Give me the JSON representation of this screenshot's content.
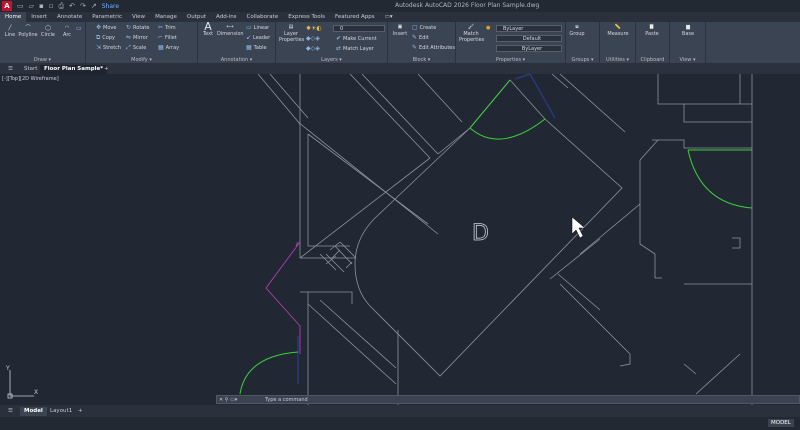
{
  "titlebar": {
    "app_logo": "A",
    "share_label": "Share",
    "title": "Autodesk AutoCAD 2026    Floor Plan Sample.dwg"
  },
  "menubar": {
    "tabs": [
      "Home",
      "Insert",
      "Annotate",
      "Parametric",
      "View",
      "Manage",
      "Output",
      "Add-ins",
      "Collaborate",
      "Express Tools",
      "Featured Apps"
    ]
  },
  "ribbon": {
    "draw": {
      "title": "Draw ▾",
      "line": "Line",
      "polyline": "Polyline",
      "circle": "Circle",
      "arc": "Arc"
    },
    "modify": {
      "title": "Modify ▾",
      "move": "Move",
      "rotate": "Rotate",
      "trim": "Trim",
      "copy": "Copy",
      "mirror": "Mirror",
      "fillet": "Fillet",
      "stretch": "Stretch",
      "scale": "Scale",
      "array": "Array"
    },
    "annotation": {
      "title": "Annotation ▾",
      "text": "Text",
      "dimension": "Dimension",
      "linear": "Linear",
      "leader": "Leader",
      "table": "Table"
    },
    "layers": {
      "title": "Layers ▾",
      "layer_properties": "Layer Properties",
      "current_layer": "0",
      "make_current": "Make Current",
      "match_layer": "Match Layer"
    },
    "block": {
      "title": "Block ▾",
      "insert": "Insert",
      "create": "Create",
      "edit": "Edit",
      "edit_attributes": "Edit Attributes"
    },
    "properties": {
      "title": "Properties ▾",
      "match_properties": "Match Properties",
      "color": "ByLayer",
      "lineweight": "Default",
      "linetype": "ByLayer"
    },
    "groups": {
      "title": "Groups ▾",
      "group": "Group"
    },
    "utilities": {
      "title": "Utilities ▾",
      "measure": "Measure"
    },
    "clipboard": {
      "title": "Clipboard",
      "paste": "Paste"
    },
    "view": {
      "title": "View ▾",
      "base": "Base"
    }
  },
  "doctabs": {
    "start": "Start",
    "active": "Floor Plan Sample*",
    "add": "+"
  },
  "viewport": {
    "label": "[-][Top][2D Wireframe]",
    "room_tag": "D"
  },
  "ucs": {
    "y": "Y",
    "x": "X"
  },
  "command": {
    "placeholder": "Type a command"
  },
  "status": {
    "model_tab": "Model",
    "layout_tab": "Layout1",
    "add": "+",
    "model_indicator": "MODEL"
  },
  "colors": {
    "background": "#212833",
    "ribbon": "#3b4452",
    "door_swing": "#3ad13a",
    "magenta": "#b23db2",
    "wall": "#8a93a0"
  }
}
